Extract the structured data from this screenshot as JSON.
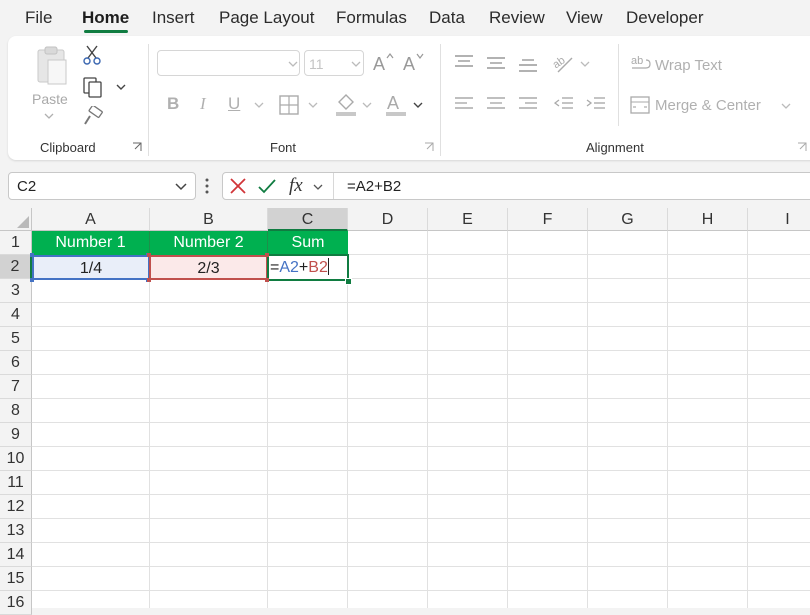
{
  "menu": {
    "tabs": [
      "File",
      "Home",
      "Insert",
      "Page Layout",
      "Formulas",
      "Data",
      "Review",
      "View",
      "Developer"
    ],
    "active": "Home"
  },
  "ribbon": {
    "clipboard": {
      "label": "Clipboard",
      "paste_label": "Paste"
    },
    "font": {
      "label": "Font",
      "size_value": "11",
      "bold": "B",
      "italic": "I",
      "underline": "U"
    },
    "alignment": {
      "label": "Alignment",
      "wrap_text": "Wrap Text",
      "merge_center": "Merge & Center"
    }
  },
  "formula_bar": {
    "name_box": "C2",
    "fx": "fx",
    "formula": "=A2+B2"
  },
  "grid": {
    "columns": [
      "A",
      "B",
      "C",
      "D",
      "E",
      "F",
      "G",
      "H",
      "I"
    ],
    "rows": [
      "1",
      "2",
      "3",
      "4",
      "5",
      "6",
      "7",
      "8",
      "9",
      "10",
      "11",
      "12",
      "13",
      "14",
      "15",
      "16"
    ],
    "header_row": [
      "Number 1",
      "Number 2",
      "Sum"
    ],
    "data_row": {
      "a2": "1/4",
      "b2": "2/3",
      "c2_eq": "=",
      "c2_ref1": "A2",
      "c2_plus": "+",
      "c2_ref2": "B2"
    },
    "selected_cell": "C2"
  },
  "colors": {
    "accent": "#107c41",
    "header_fill": "#00b050",
    "ref_blue": "#4472c4",
    "ref_red": "#c0504d",
    "ref_red_fill": "#fbe9e9",
    "ref_blue_fill": "#e9eef9"
  },
  "icons": [
    "cut-icon",
    "copy-icon",
    "format-painter-icon",
    "increase-font-icon",
    "decrease-font-icon",
    "borders-icon",
    "fill-color-icon",
    "font-color-icon",
    "align-top-icon",
    "align-middle-icon",
    "align-bottom-icon",
    "orientation-icon",
    "align-left-icon",
    "align-center-icon",
    "align-right-icon",
    "decrease-indent-icon",
    "increase-indent-icon",
    "wrap-text-icon",
    "merge-icon",
    "cancel-icon",
    "enter-icon",
    "function-icon"
  ]
}
